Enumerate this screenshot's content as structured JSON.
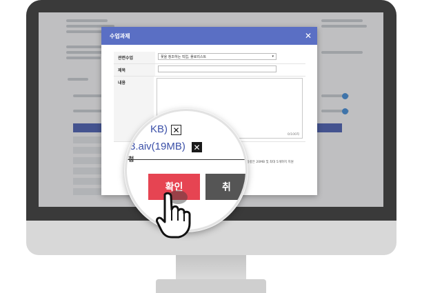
{
  "modal": {
    "title": "수업과제",
    "close_icon": "close-icon",
    "fields": {
      "class_label": "관련수업",
      "class_value": "꽃을 청조하는 직업, 플로리스트",
      "subject_label": "제목",
      "content_label": "내용",
      "char_count": "0/100자"
    },
    "attach_note": "• 개별 파일 용량은 20MB 및 최대 5개까지 지원"
  },
  "magnifier": {
    "file_1_text": "KB)",
    "file_2_text": "3.aiv(19MB)",
    "attach_label": "첨",
    "confirm_label": "확인",
    "cancel_label": "취"
  },
  "colors": {
    "modal_header": "#5a6fc4",
    "confirm_button": "#e64452",
    "cancel_button": "#555555"
  },
  "icons": {
    "remove_file": "close-box-icon",
    "cursor": "pointing-hand-icon"
  }
}
